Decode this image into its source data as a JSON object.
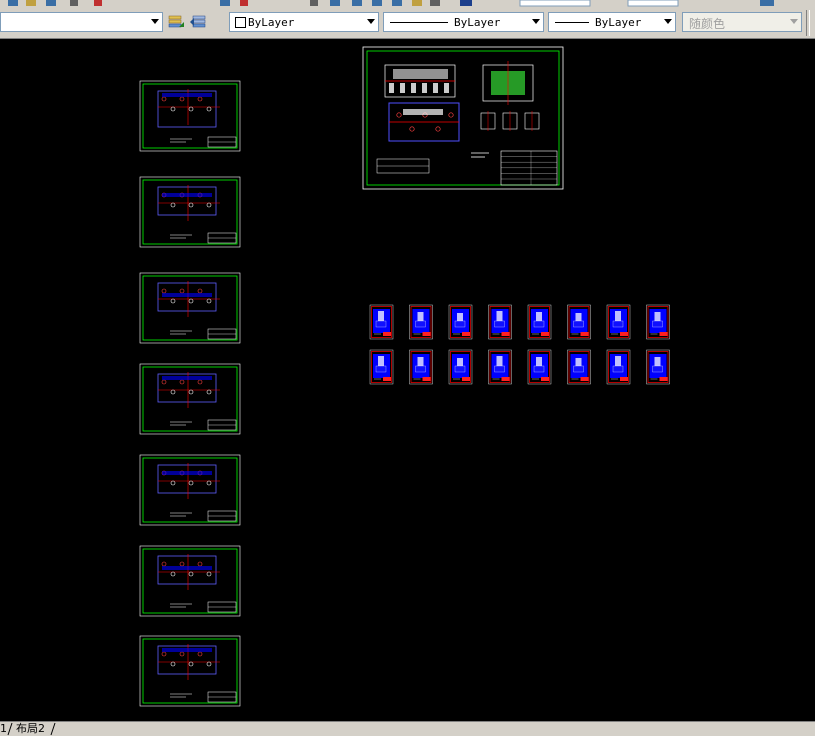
{
  "properties_bar": {
    "layer_combo": {
      "icon": "layer-dropdown",
      "value": ""
    },
    "color_combo": {
      "value": "ByLayer",
      "icon": "white-square-swatch"
    },
    "linetype_combo": {
      "value": "ByLayer"
    },
    "lineweight_combo": {
      "value": "ByLayer"
    },
    "plotstyle_combo": {
      "value": "随颜色",
      "enabled": false
    }
  },
  "layout_tabs": [
    {
      "label": "1"
    },
    {
      "label": "布局2"
    }
  ],
  "canvas": {
    "background": "#000000",
    "sheet_frame_color": "#00ff00",
    "detail_frame_color": "#ff0000",
    "fill_color": "#0000ff",
    "left_sheet_column_count": 7,
    "main_assembly_sheet_count": 1,
    "part_drawing_rows": [
      {
        "count": 8
      },
      {
        "count": 8
      }
    ]
  }
}
